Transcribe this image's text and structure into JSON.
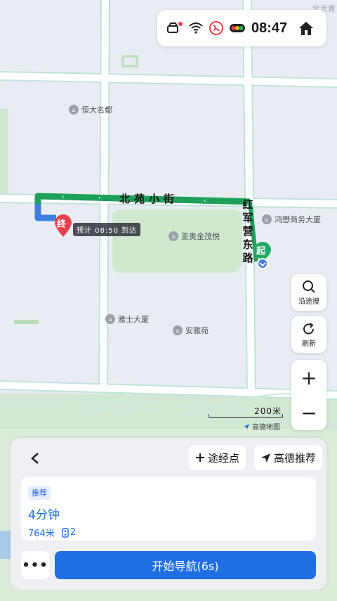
{
  "status": {
    "time": "08:47",
    "icons": [
      "car-icon",
      "wifi-icon",
      "signal-off-icon",
      "traffic-light-icon"
    ],
    "home_icon": "home-icon"
  },
  "map": {
    "corner_label": "北京青",
    "roads": {
      "horizontal": "北苑小街",
      "vertical": [
        "红",
        "军",
        "营",
        "东",
        "路"
      ]
    },
    "pois": {
      "p1": "恒大名都",
      "p2": "鸿懋商务大厦",
      "p3": "亚奥金茂悦",
      "p4": "雅士大厦",
      "p5": "安雅苑"
    },
    "end_marker": "终",
    "eta_tag": "预计 08:50 到达",
    "start_marker": "起",
    "scale_text": "200米",
    "logo_text": "高德地图",
    "route_color": "#1fa05a"
  },
  "tools": {
    "search_label": "沿途搜",
    "refresh_label": "刷新",
    "zoom_in": "+",
    "zoom_out": "−"
  },
  "panel": {
    "waypoint_label": "途经点",
    "recommend_label": "高德推荐",
    "route": {
      "badge": "推荐",
      "duration": "4分钟",
      "distance": "764米",
      "lights": "2"
    },
    "more_label": "•••",
    "start_label": "开始导航(6s)"
  },
  "colors": {
    "accent": "#1f6fe5",
    "route": "#1fa05a",
    "end_pin": "#e8414b",
    "start_pin": "#22a866"
  }
}
